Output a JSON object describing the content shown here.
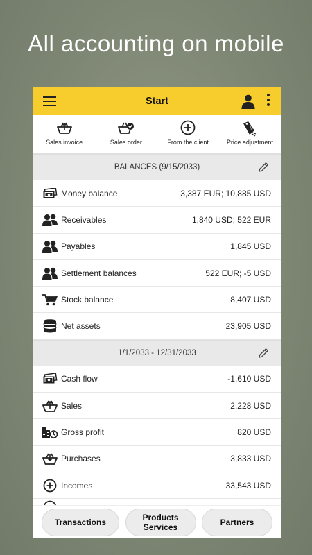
{
  "promo": {
    "headline": "All accounting on mobile"
  },
  "appbar": {
    "title": "Start"
  },
  "actions": [
    {
      "label": "Sales invoice",
      "icon": "basket-out-icon"
    },
    {
      "label": "Sales order",
      "icon": "basket-check-icon"
    },
    {
      "label": "From the client",
      "icon": "plus-circle-icon"
    },
    {
      "label": "Price adjustment",
      "icon": "price-tag-icon"
    }
  ],
  "balances": {
    "header": "BALANCES (9/15/2033)",
    "rows": [
      {
        "label": "Money balance",
        "value": "3,387 EUR; 10,885 USD",
        "icon": "banknote-icon"
      },
      {
        "label": "Receivables",
        "value": "1,840 USD; 522 EUR",
        "icon": "people-icon"
      },
      {
        "label": "Payables",
        "value": "1,845 USD",
        "icon": "people-icon"
      },
      {
        "label": "Settlement balances",
        "value": "522 EUR; -5 USD",
        "icon": "people-icon"
      },
      {
        "label": "Stock balance",
        "value": "8,407 USD",
        "icon": "cart-icon"
      },
      {
        "label": "Net assets",
        "value": "23,905 USD",
        "icon": "coin-stack-icon"
      }
    ]
  },
  "period": {
    "header": "1/1/2033 - 12/31/2033",
    "rows": [
      {
        "label": "Cash flow",
        "value": "-1,610 USD",
        "icon": "banknote-icon"
      },
      {
        "label": "Sales",
        "value": "2,228 USD",
        "icon": "basket-out-icon"
      },
      {
        "label": "Gross profit",
        "value": "820 USD",
        "icon": "coins-clock-icon"
      },
      {
        "label": "Purchases",
        "value": "3,833 USD",
        "icon": "basket-in-icon"
      },
      {
        "label": "Incomes",
        "value": "33,543 USD",
        "icon": "plus-circle-icon"
      }
    ]
  },
  "bottom_nav": {
    "transactions": "Transactions",
    "products_line1": "Products",
    "products_line2": "Services",
    "partners": "Partners"
  },
  "colors": {
    "appbar": "#f6cd2c",
    "section_bg": "#e9e9e9",
    "pill_bg": "#ececec"
  }
}
